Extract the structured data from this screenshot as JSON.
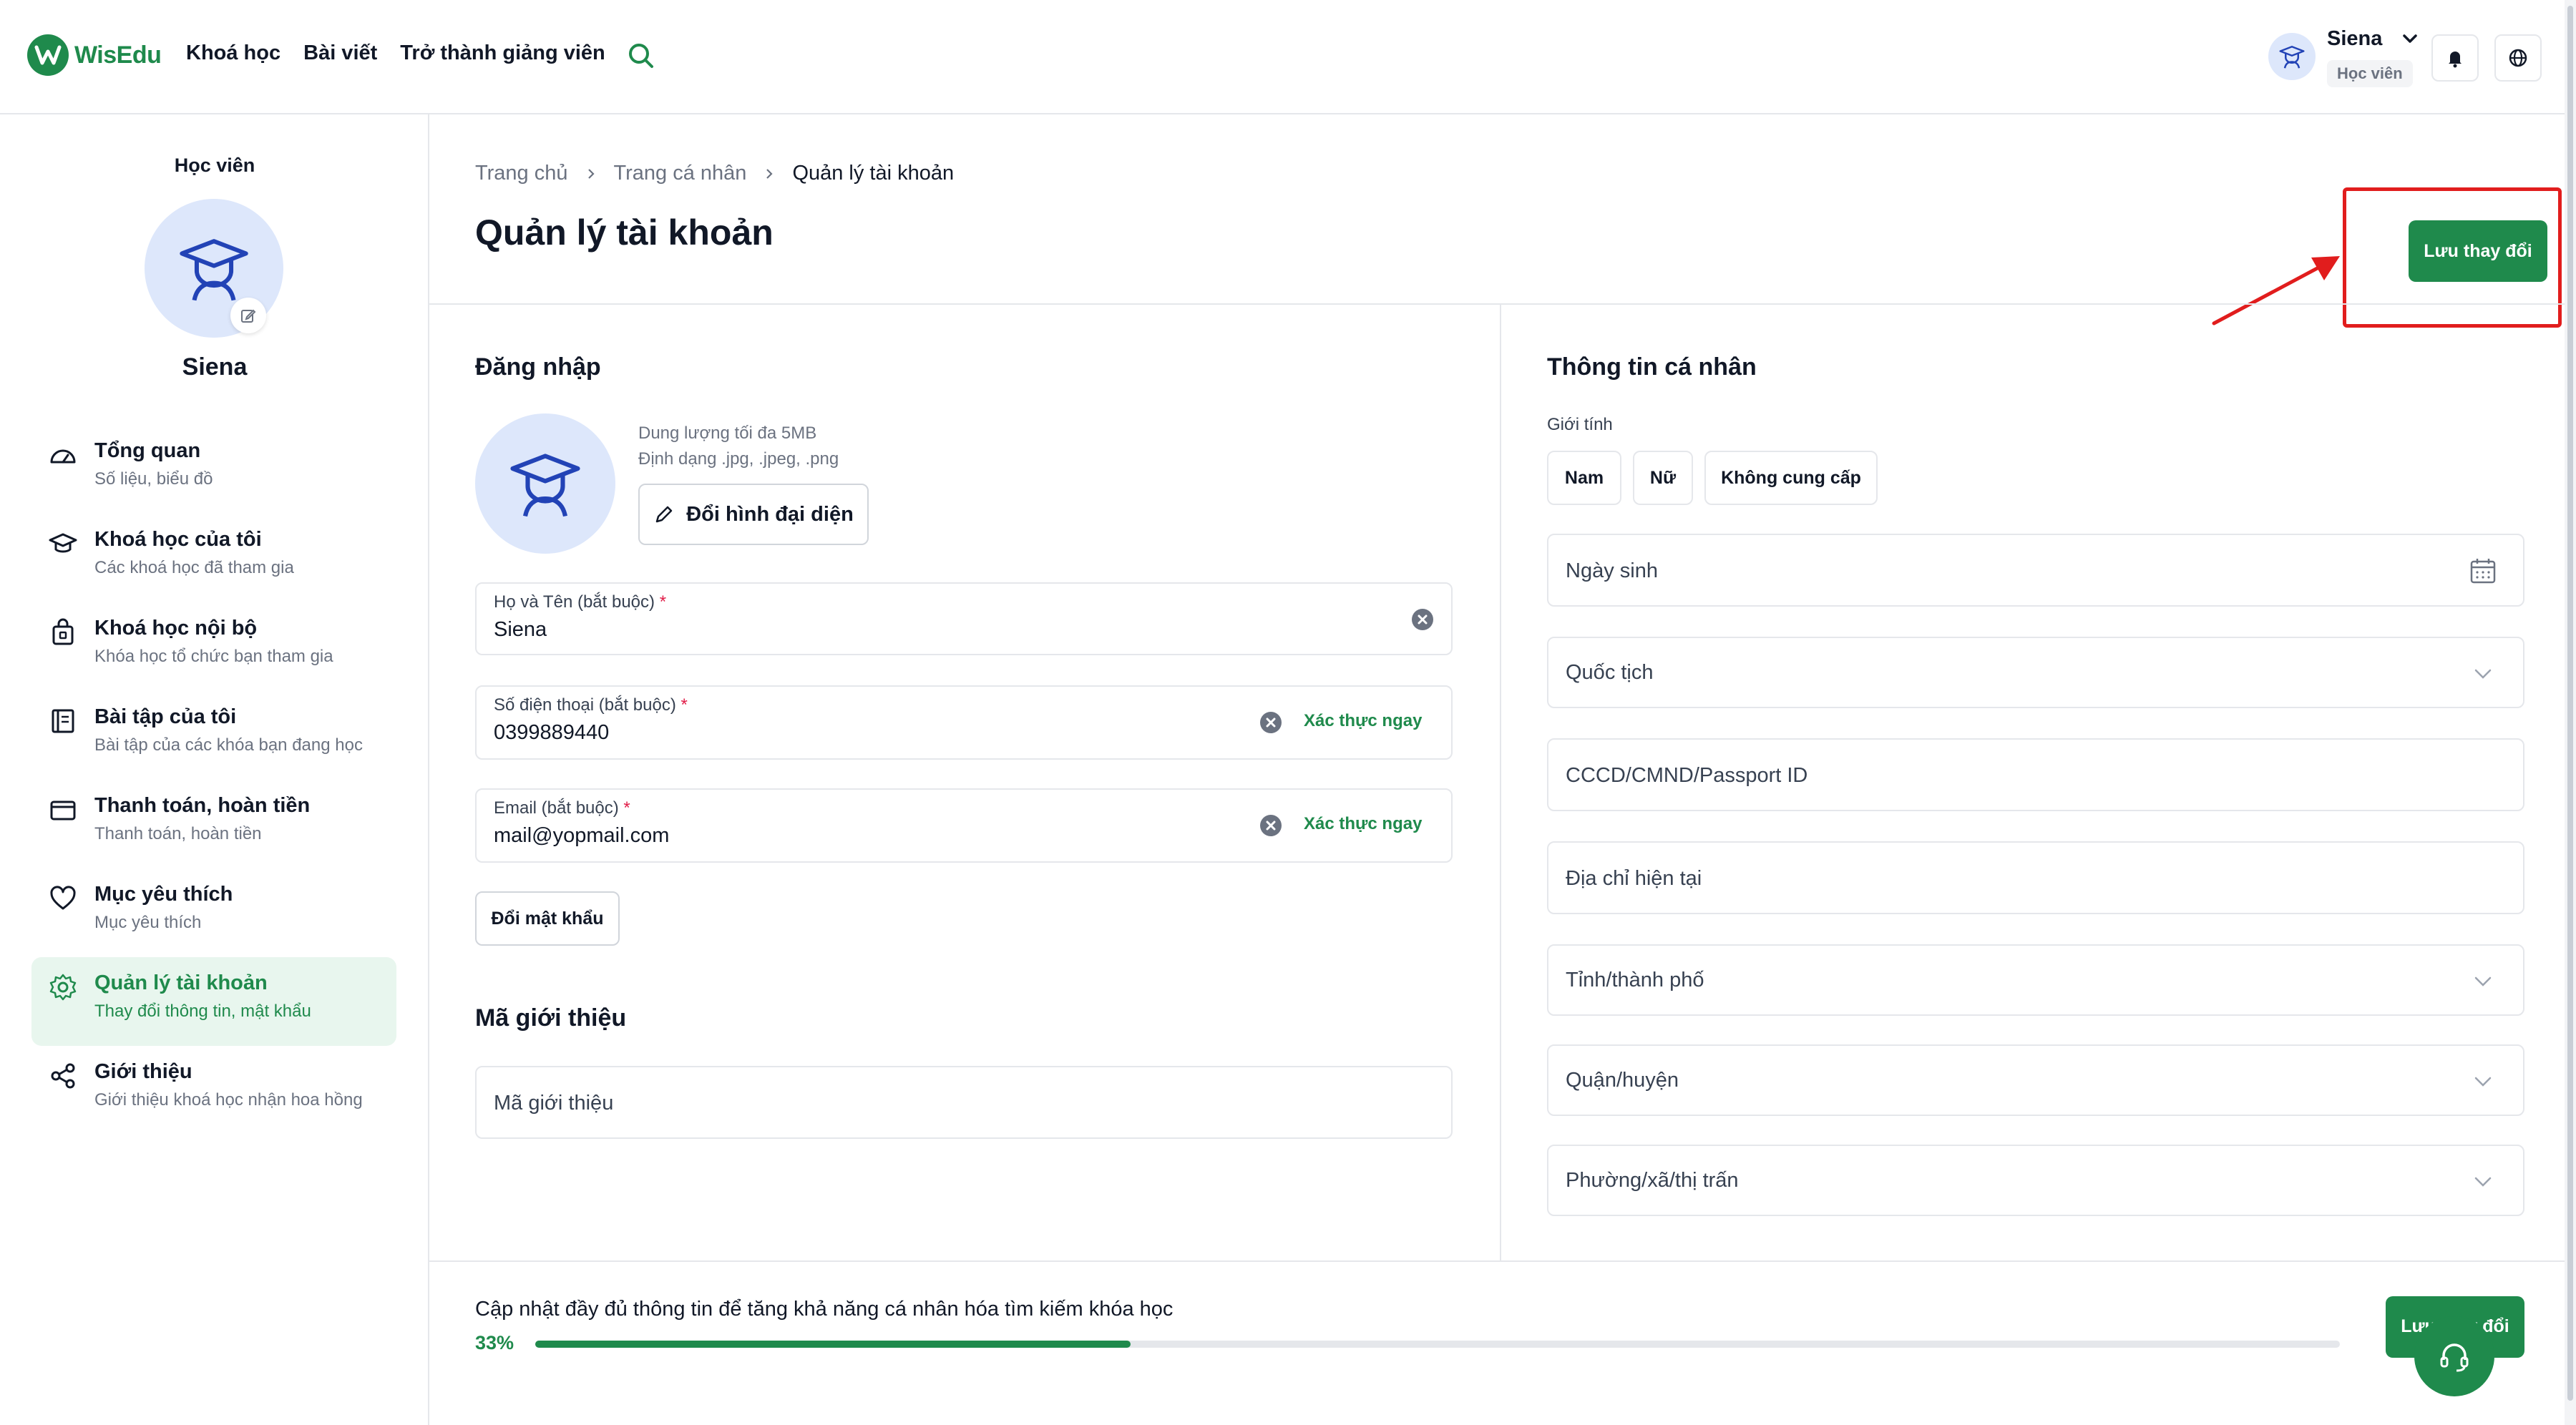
{
  "header": {
    "brand": "WisEdu",
    "nav": [
      "Khoá học",
      "Bài viết",
      "Trở thành giảng viên"
    ],
    "user_name": "Siena",
    "user_role": "Học viên"
  },
  "sidebar": {
    "role": "Học viên",
    "name": "Siena",
    "items": [
      {
        "title": "Tổng quan",
        "subtitle": "Số liệu, biểu đồ",
        "icon": "dashboard-icon"
      },
      {
        "title": "Khoá học của tôi",
        "subtitle": "Các khoá học đã tham gia",
        "icon": "graduation-cap-icon"
      },
      {
        "title": "Khoá học nội bộ",
        "subtitle": "Khóa học tổ chức bạn tham gia",
        "icon": "lock-bag-icon"
      },
      {
        "title": "Bài tập của tôi",
        "subtitle": "Bài tập của các khóa bạn đang học",
        "icon": "notebook-icon"
      },
      {
        "title": "Thanh toán, hoàn tiền",
        "subtitle": "Thanh toán, hoàn tiền",
        "icon": "wallet-icon"
      },
      {
        "title": "Mục yêu thích",
        "subtitle": "Mục yêu thích",
        "icon": "heart-icon"
      },
      {
        "title": "Quản lý tài khoản",
        "subtitle": "Thay đổi thông tin, mật khẩu",
        "icon": "gear-icon"
      },
      {
        "title": "Giới thiệu",
        "subtitle": "Giới thiệu khoá học nhận hoa hồng",
        "icon": "share-icon"
      }
    ],
    "active_index": 6
  },
  "breadcrumb": [
    "Trang chủ",
    "Trang cá nhân",
    "Quản lý tài khoản"
  ],
  "page_title": "Quản lý tài khoản",
  "save_label": "Lưu thay đổi",
  "login": {
    "title": "Đăng nhập",
    "upload_hint_1": "Dung lượng tối đa 5MB",
    "upload_hint_2": "Định dạng .jpg, .jpeg, .png",
    "change_avatar": "Đổi hình đại diện",
    "full_name_label": "Họ và Tên (bắt buộc)",
    "full_name_value": "Siena",
    "phone_label": "Số điện thoại (bắt buộc)",
    "phone_value": "0399889440",
    "email_label": "Email (bắt buộc)",
    "email_value": "mail@yopmail.com",
    "required_mark": "*",
    "verify_label": "Xác thực ngay",
    "change_password": "Đổi mật khẩu"
  },
  "referral": {
    "title": "Mã giới thiệu",
    "placeholder": "Mã giới thiệu"
  },
  "personal": {
    "title": "Thông tin cá nhân",
    "gender_label": "Giới tính",
    "gender_options": [
      "Nam",
      "Nữ",
      "Không cung cấp"
    ],
    "birthday": "Ngày sinh",
    "nationality": "Quốc tịch",
    "id_number": "CCCD/CMND/Passport ID",
    "address": "Địa chỉ hiện tại",
    "province": "Tỉnh/thành phố",
    "district": "Quận/huyện",
    "ward": "Phường/xã/thị trấn"
  },
  "progress": {
    "text": "Cập nhật đầy đủ thông tin để tăng khả năng cá nhân hóa tìm kiếm khóa học",
    "percent_label": "33%",
    "value": 0.33
  },
  "colors": {
    "brand": "#1f8a4c",
    "highlight": "#e11d1d"
  }
}
